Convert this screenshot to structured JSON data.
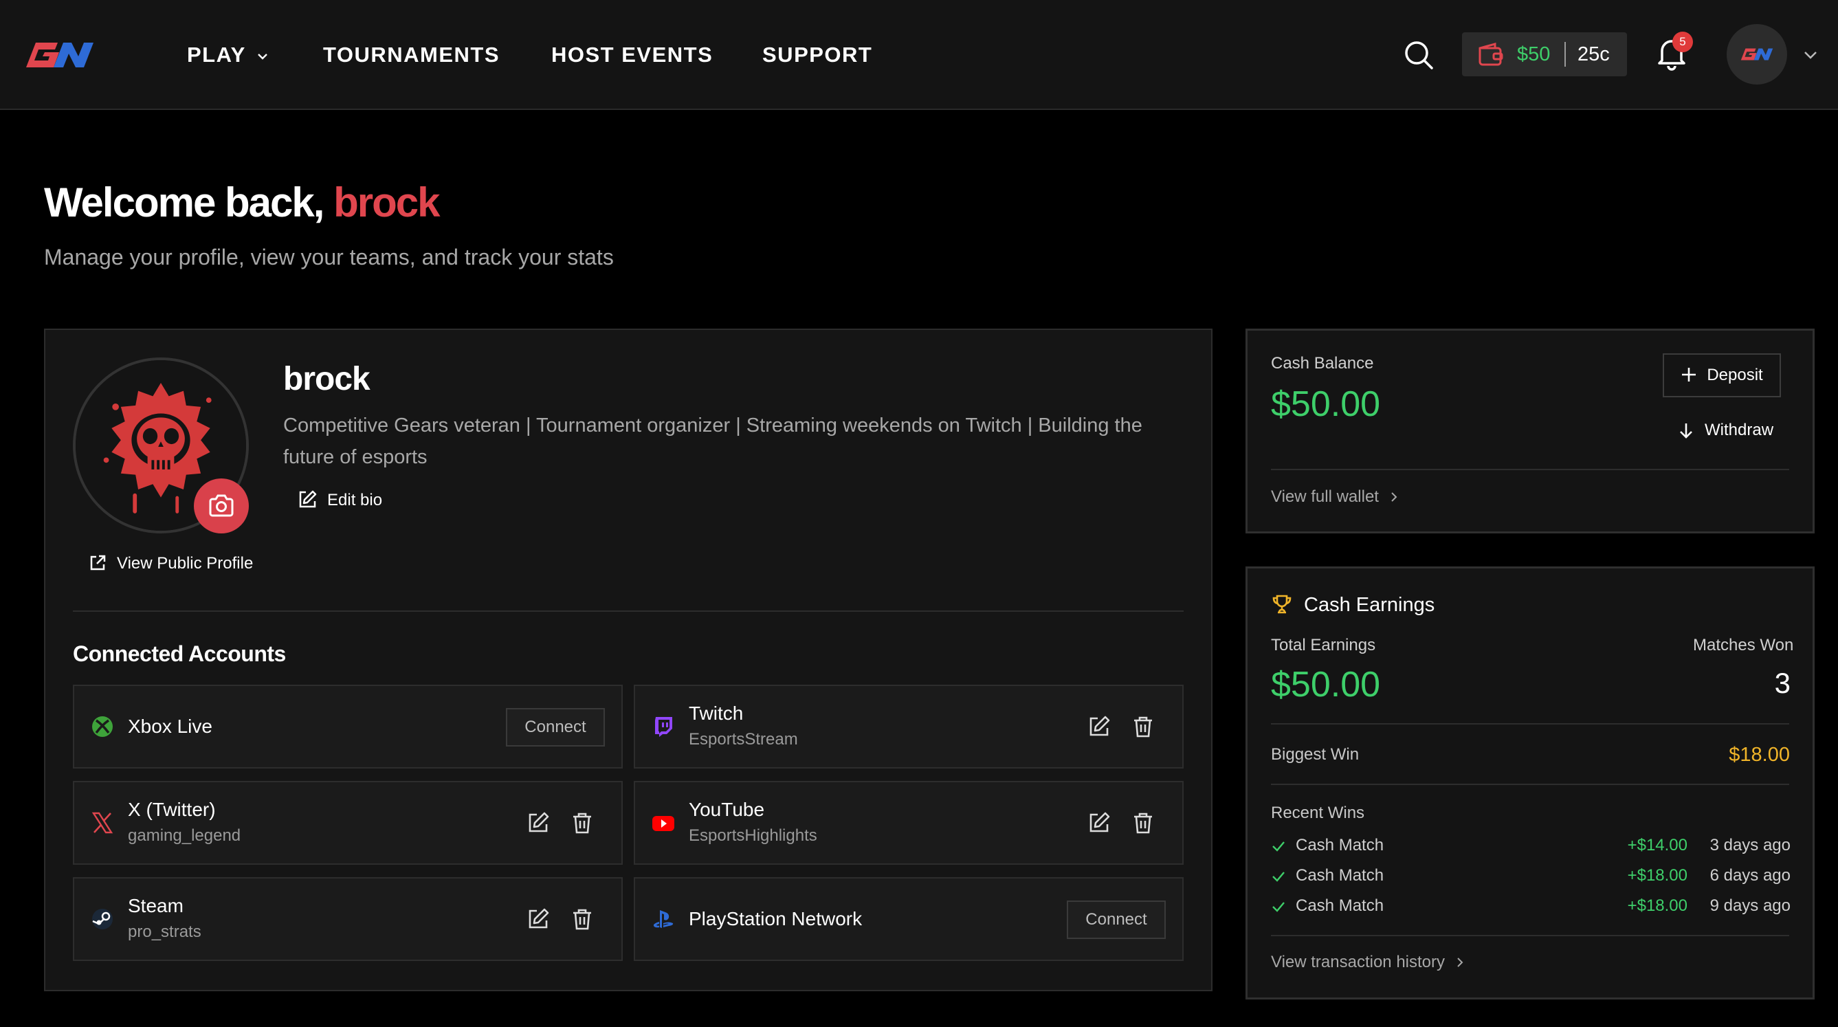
{
  "nav": {
    "logo_text": "GN",
    "play": "PLAY",
    "tournaments": "TOURNAMENTS",
    "host_events": "HOST EVENTS",
    "support": "SUPPORT",
    "wallet_cash": "$50",
    "wallet_coins": "25c",
    "notification_count": "5"
  },
  "header": {
    "welcome_prefix": "Welcome back,",
    "username": "brock",
    "subtitle": "Manage your profile, view your teams, and track your stats"
  },
  "profile": {
    "name": "brock",
    "bio": "Competitive Gears veteran | Tournament organizer | Streaming weekends on Twitch | Building the future of esports",
    "edit_bio": "Edit bio",
    "view_public": "View Public Profile"
  },
  "connected": {
    "title": "Connected Accounts",
    "accounts": [
      {
        "platform": "Xbox Live",
        "username": "",
        "connected": false,
        "action": "Connect",
        "icon": "xbox-icon",
        "color": "#3ea33a"
      },
      {
        "platform": "Twitch",
        "username": "EsportsStream",
        "connected": true,
        "icon": "twitch-icon",
        "color": "#9146ff"
      },
      {
        "platform": "X (Twitter)",
        "username": "gaming_legend",
        "connected": true,
        "icon": "x-twitter-icon",
        "color": "#e0464e"
      },
      {
        "platform": "YouTube",
        "username": "EsportsHighlights",
        "connected": true,
        "icon": "youtube-icon",
        "color": "#ff0000"
      },
      {
        "platform": "Steam",
        "username": "pro_strats",
        "connected": true,
        "icon": "steam-icon",
        "color": "#1b2838"
      },
      {
        "platform": "PlayStation Network",
        "username": "",
        "connected": false,
        "action": "Connect",
        "icon": "playstation-icon",
        "color": "#2e6bd6"
      }
    ]
  },
  "wallet": {
    "label": "Cash Balance",
    "amount": "$50.00",
    "deposit": "Deposit",
    "withdraw": "Withdraw",
    "view_link": "View full wallet"
  },
  "earnings": {
    "title": "Cash Earnings",
    "total_label": "Total Earnings",
    "total": "$50.00",
    "matches_label": "Matches Won",
    "matches": "3",
    "biggest_label": "Biggest Win",
    "biggest": "$18.00",
    "recent_label": "Recent Wins",
    "recent": [
      {
        "type": "Cash Match",
        "amount": "+$14.00",
        "time": "3 days ago"
      },
      {
        "type": "Cash Match",
        "amount": "+$18.00",
        "time": "6 days ago"
      },
      {
        "type": "Cash Match",
        "amount": "+$18.00",
        "time": "9 days ago"
      }
    ],
    "history_link": "View transaction history"
  },
  "colors": {
    "accent": "#e0464e",
    "green": "#3ecf6a",
    "gold": "#f0b429",
    "bg": "#000000",
    "card": "#151515"
  }
}
